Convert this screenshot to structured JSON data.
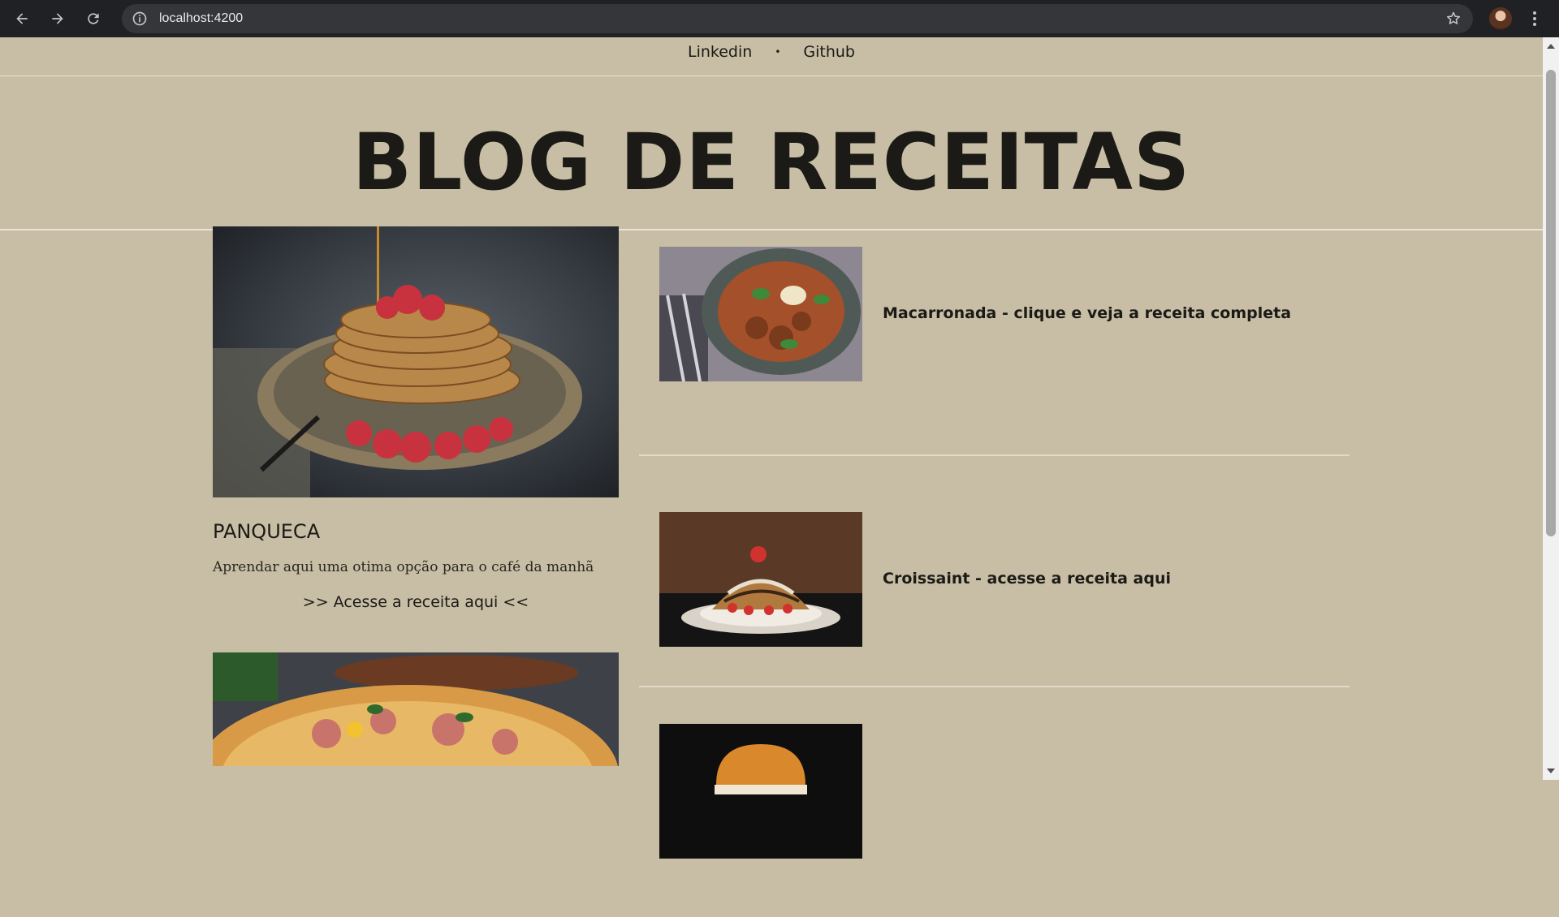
{
  "browser": {
    "url": "localhost:4200",
    "icons": [
      "back-arrow-icon",
      "forward-arrow-icon",
      "reload-icon",
      "site-info-icon",
      "bookmark-star-icon",
      "profile-avatar",
      "kebab-menu-icon"
    ]
  },
  "nav": {
    "links": [
      "Linkedin",
      "Github"
    ],
    "separator": "•"
  },
  "header": {
    "title": "BLOG DE RECEITAS"
  },
  "featured": {
    "title": "PANQUECA",
    "description": "Aprendar aqui uma otima opção para o café da manhã",
    "link": ">> Acesse a receita aqui <<"
  },
  "recipes": [
    {
      "title": "Macarronada - clique e veja a receita completa"
    },
    {
      "title": "Croissaint - acesse a receita aqui"
    },
    {
      "title": ""
    }
  ],
  "colors": {
    "page_bg": "#c7bea5",
    "text": "#1c1a16",
    "chrome_bg": "#202124",
    "omnibox_bg": "#35363a"
  }
}
